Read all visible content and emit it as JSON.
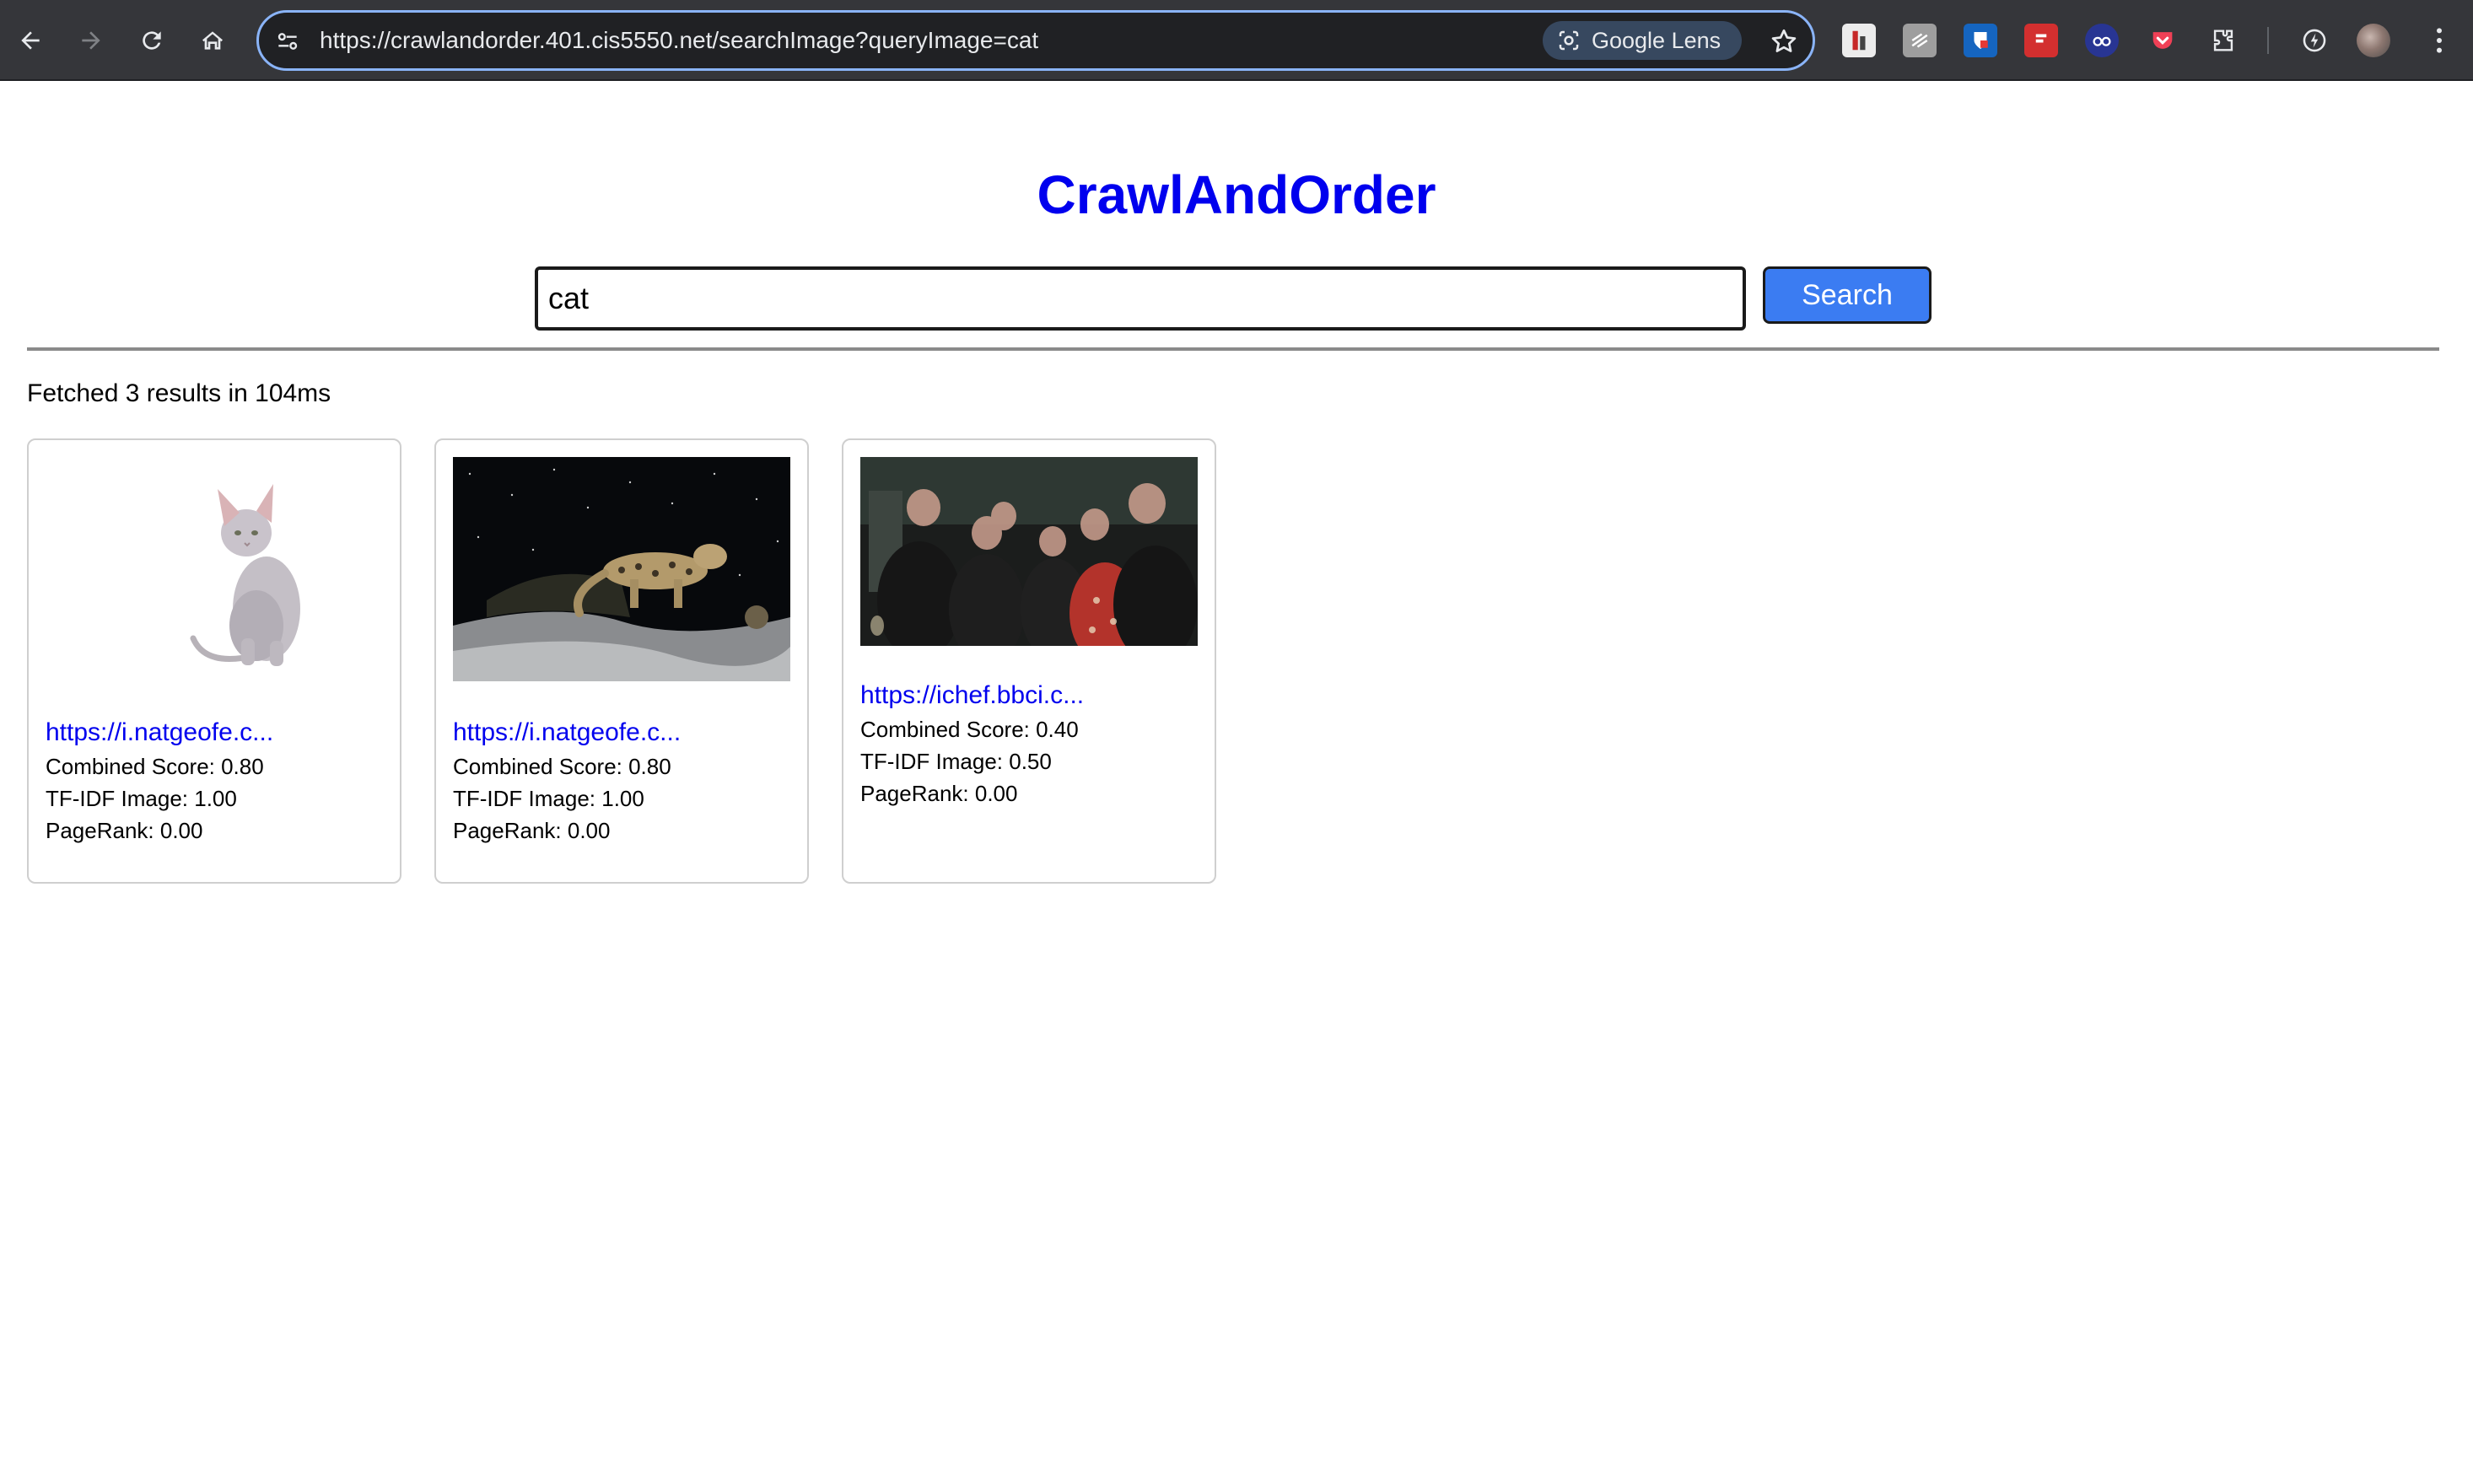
{
  "browser": {
    "url": "https://crawlandorder.401.cis5550.net/searchImage?queryImage=cat",
    "lens_label": "Google Lens",
    "icons": [
      "back-icon",
      "forward-icon",
      "reload-icon",
      "home-icon",
      "site-settings-icon",
      "google-lens-icon",
      "bookmark-star-icon",
      "extensions-puzzle-icon",
      "performance-icon",
      "profile-avatar",
      "kebab-menu-icon"
    ]
  },
  "app": {
    "title": "CrawlAndOrder",
    "search_value": "cat",
    "search_button": "Search",
    "stats": "Fetched 3 results in 104ms",
    "link_color": "#0000ee",
    "button_color": "#3b7cf2"
  },
  "results": [
    {
      "link": "https://i.natgeofe.c...",
      "combined": "Combined Score: 0.80",
      "tfidf": "TF-IDF Image: 1.00",
      "pagerank": "PageRank: 0.00",
      "image": "hairless sphynx cat on white background"
    },
    {
      "link": "https://i.natgeofe.c...",
      "combined": "Combined Score: 0.80",
      "tfidf": "TF-IDF Image: 1.00",
      "pagerank": "PageRank: 0.00",
      "image": "snow leopard in snowy night scene"
    },
    {
      "link": "https://ichef.bbci.c...",
      "combined": "Combined Score: 0.40",
      "tfidf": "TF-IDF Image: 0.50",
      "pagerank": "PageRank: 0.00",
      "image": "group photo of people, faces blurred"
    }
  ]
}
